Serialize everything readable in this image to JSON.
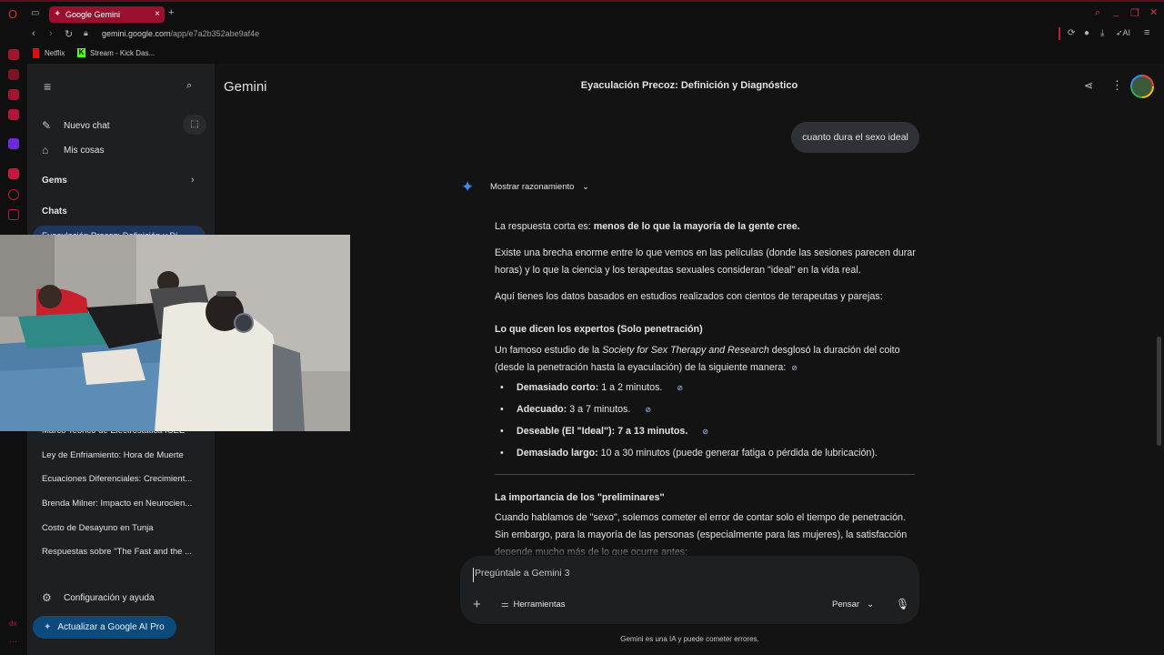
{
  "browser": {
    "tab_title": "Google Gemini",
    "new_tab_symbol": "+",
    "url_host": "gemini.google.com",
    "url_path": "/app/e7a2b352abe9af4e",
    "ai_label": "AI",
    "bookmarks": [
      {
        "label": "Netflix"
      },
      {
        "label": "Stream - Kick Das..."
      }
    ],
    "side_bottom_label": "dx"
  },
  "sidebar": {
    "new_chat": "Nuevo chat",
    "my_stuff": "Mis cosas",
    "gems": "Gems",
    "chats_header": "Chats",
    "active_chat_partial": "Eyaculación Precoz: Definición y Di...",
    "history": [
      "Marco Teórico de Electrostática ICEE",
      "Ley de Enfriamiento: Hora de Muerte",
      "Ecuaciones Diferenciales: Crecimient...",
      "Brenda Milner: Impacto en Neurocien...",
      "Costo de Desayuno en Tunja",
      "Respuestas sobre \"The Fast and the ..."
    ],
    "settings": "Configuración y ayuda",
    "upgrade": "Actualizar a Google AI Pro"
  },
  "header": {
    "brand": "Gemini",
    "conversation_title": "Eyaculación Precoz: Definición y Diagnóstico"
  },
  "chat": {
    "user_message": "cuanto dura el sexo ideal",
    "show_reasoning": "Mostrar razonamiento",
    "p1_lead": "La respuesta corta es: ",
    "p1_bold": "menos de lo que la mayoría de la gente cree.",
    "p2": "Existe una brecha enorme entre lo que vemos en las películas (donde las sesiones parecen durar horas) y lo que la ciencia y los terapeutas sexuales consideran \"ideal\" en la vida real.",
    "p3": "Aquí tienes los datos basados en estudios realizados con cientos de terapeutas y parejas:",
    "h1": "Lo que dicen los expertos (Solo penetración)",
    "p4_a": "Un famoso estudio de la ",
    "p4_italic": "Society for Sex Therapy and Research",
    "p4_b": " desglosó la duración del coito (desde la penetración hasta la eyaculación) de la siguiente manera:",
    "bullets": [
      {
        "bold": "Demasiado corto:",
        "text": " 1 a 2 minutos."
      },
      {
        "bold": "Adecuado:",
        "text": " 3 a 7 minutos."
      },
      {
        "bold": "Deseable (El \"Ideal\"): 7 a 13 minutos.",
        "text": ""
      },
      {
        "bold": "Demasiado largo:",
        "text": " 10 a 30 minutos (puede generar fatiga o pérdida de lubricación)."
      }
    ],
    "h2": "La importancia de los \"preliminares\"",
    "p5": "Cuando hablamos de \"sexo\", solemos cometer el error de contar solo el tiempo de penetración. Sin embargo, para la mayoría de las personas (especialmente para las mujeres), la satisfacción depende mucho más de lo que ocurre antes:"
  },
  "composer": {
    "placeholder": "Pregúntale a Gemini 3",
    "tools": "Herramientas",
    "mode": "Pensar"
  },
  "footer": {
    "disclaimer": "Gemini es una IA y puede cometer errores."
  },
  "colors": {
    "accent_tab": "#9a0f2e",
    "background": "#131314",
    "sidebar": "#1e1f20",
    "gemini_blue": "#4285f4"
  }
}
